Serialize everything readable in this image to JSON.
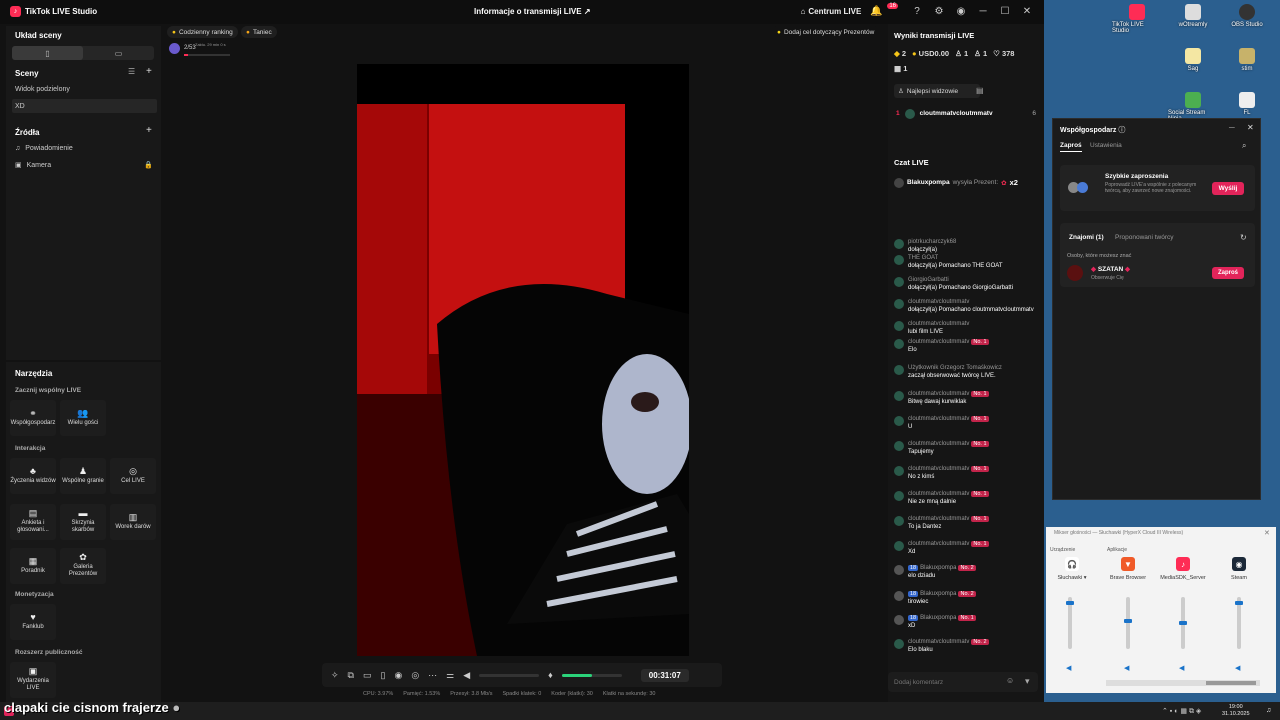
{
  "window": {
    "app_title": "TikTok LIVE Studio",
    "center_title": "Informacje o transmisji LIVE",
    "centrum": "Centrum LIVE",
    "notif_count": "16"
  },
  "left": {
    "scene_layout": "Układ sceny",
    "scenes_title": "Sceny",
    "scenes": [
      "Widok podzielony",
      "XD"
    ],
    "sources_title": "Źródła",
    "sources": [
      "Powiadomienie",
      "Kamera"
    ]
  },
  "tools": {
    "title": "Narzędzia",
    "sec1": "Zacznij wspólny LIVE",
    "cohost": "Współgospodarz",
    "multi": "Wielu gości",
    "sec2": "Interakcja",
    "wishes": "Życzenia widzów",
    "games": "Wspólne granie",
    "goal": "Cel LIVE",
    "poll": "Ankieta i głosowani...",
    "treasure": "Skrzynia skarbów",
    "bag": "Worek darów",
    "guide": "Poradnik",
    "gallery": "Galeria Prezentów",
    "sec3": "Monetyzacja",
    "fanclub": "Fanklub",
    "sec4": "Rozszerz publiczność",
    "events": "Wydarzenia LIVE"
  },
  "preview": {
    "daily": "Codzienny ranking",
    "dancer": "Taniec",
    "rank_text": "2/53",
    "rank_sub": "Zaktu. 29 min 0 s",
    "gift_goal": "Dodaj cel dotyczący Prezentów",
    "timer": "00:31:07",
    "stats": [
      "CPU: 3.97%",
      "Pamięć: 1.53%",
      "Przesył: 3.8 Mb/s",
      "Spadki klatek: 0",
      "Koder (klatki): 30",
      "Klatki na sekundę: 30"
    ]
  },
  "right": {
    "results_title": "Wyniki transmisji LIVE",
    "coins": "2",
    "usd": "USD0.00",
    "likes": "1",
    "followers": "1",
    "viewers": "378",
    "people": "1",
    "top_viewers": "Najlepsi widzowie",
    "top1_rank": "1",
    "top1_name": "cloutmmatvcloutmmatv",
    "top1_score": "6",
    "chat_title": "Czat LIVE",
    "gift_user": "Blakuxpompa",
    "gift_action": "wysyła Prezent:",
    "gift_count": "x2",
    "input_placeholder": "Dodaj komentarz"
  },
  "chat": [
    {
      "n": "piotrkucharczyk68",
      "t": "dołączył(a)",
      "b": ""
    },
    {
      "n": "THE GOAT",
      "t": "dołączył(a) Pomachano THE GOAT",
      "b": ""
    },
    {
      "n": "GiorgioGarbatti",
      "t": "dołączył(a) Pomachano GiorgioGarbatti",
      "b": ""
    },
    {
      "n": "cloutmmatvcloutmmatv",
      "t": "dołączył(a) Pomachano cloutmmatvcloutmmatv",
      "b": ""
    },
    {
      "n": "cloutmmatvcloutmmatv",
      "t": "lubi film LIVE",
      "b": ""
    },
    {
      "n": "cloutmmatvcloutmmatv",
      "t": "Elo",
      "b": "No. 1"
    },
    {
      "n": "Użytkownik Grzegorz Tomaśkowicz",
      "t": "zaczął obserwować twórcę LIVE.",
      "b": ""
    },
    {
      "n": "cloutmmatvcloutmmatv",
      "t": "Bitwę dawaj kurwiklak",
      "b": "No. 1"
    },
    {
      "n": "cloutmmatvcloutmmatv",
      "t": "U",
      "b": "No. 1"
    },
    {
      "n": "cloutmmatvcloutmmatv",
      "t": "Tapujemy",
      "b": "No. 1"
    },
    {
      "n": "cloutmmatvcloutmmatv",
      "t": "No z kimś",
      "b": "No. 1"
    },
    {
      "n": "cloutmmatvcloutmmatv",
      "t": "Nie ze mną dalnie",
      "b": "No. 1"
    },
    {
      "n": "cloutmmatvcloutmmatv",
      "t": "To ja Dantez",
      "b": "No. 1"
    },
    {
      "n": "cloutmmatvcloutmmatv",
      "t": "Xd",
      "b": "No. 1"
    },
    {
      "n": "Blakuxpompa",
      "t": "elo dziadu",
      "b": "No. 2",
      "l": "18"
    },
    {
      "n": "Blakuxpompa",
      "t": "tirowiec",
      "b": "No. 2",
      "l": "18"
    },
    {
      "n": "Blakuxpompa",
      "t": "xD",
      "b": "No. 1",
      "l": "18"
    },
    {
      "n": "cloutmmatvcloutmmatv",
      "t": "Elo blaku",
      "b": "No. 2"
    }
  ],
  "desktop": {
    "icons": [
      "TikTok LIVE Studio",
      "wOtreamly",
      "OBS Studio",
      "Sag",
      "stim",
      "Social Stream Ninja",
      "FL"
    ]
  },
  "cohost": {
    "title": "Współgospodarz",
    "tab1": "Zaproś",
    "tab2": "Ustawienia",
    "quick_title": "Szybkie zaproszenia",
    "quick_desc": "Poprowadź LIVE'a wspólnie z polecanym twórcą, aby zawrzeć nowe znajomości.",
    "send": "Wyślij",
    "friends_tab": "Znajomi (1)",
    "suggested_tab": "Proponowani twórcy",
    "people_known": "Osoby, które możesz znać",
    "user": "SZATAN",
    "user_sub": "Obserwuje Cię",
    "invite": "Zaproś"
  },
  "mixer": {
    "title": "Mikser głośności — Słuchawki (HyperX Cloud III Wireless)",
    "device_label": "Urządzenie",
    "apps_label": "Aplikacje",
    "channels": [
      "Słuchawki",
      "Brave Browser",
      "MediaSDK_Server",
      "Steam"
    ],
    "levels": [
      0.92,
      0.55,
      0.5,
      0.92
    ]
  },
  "overlay": {
    "subtitle": "clapaki cie cisnom frajerze"
  },
  "taskbar": {
    "time": "19:00",
    "date": "31.10.2025"
  }
}
